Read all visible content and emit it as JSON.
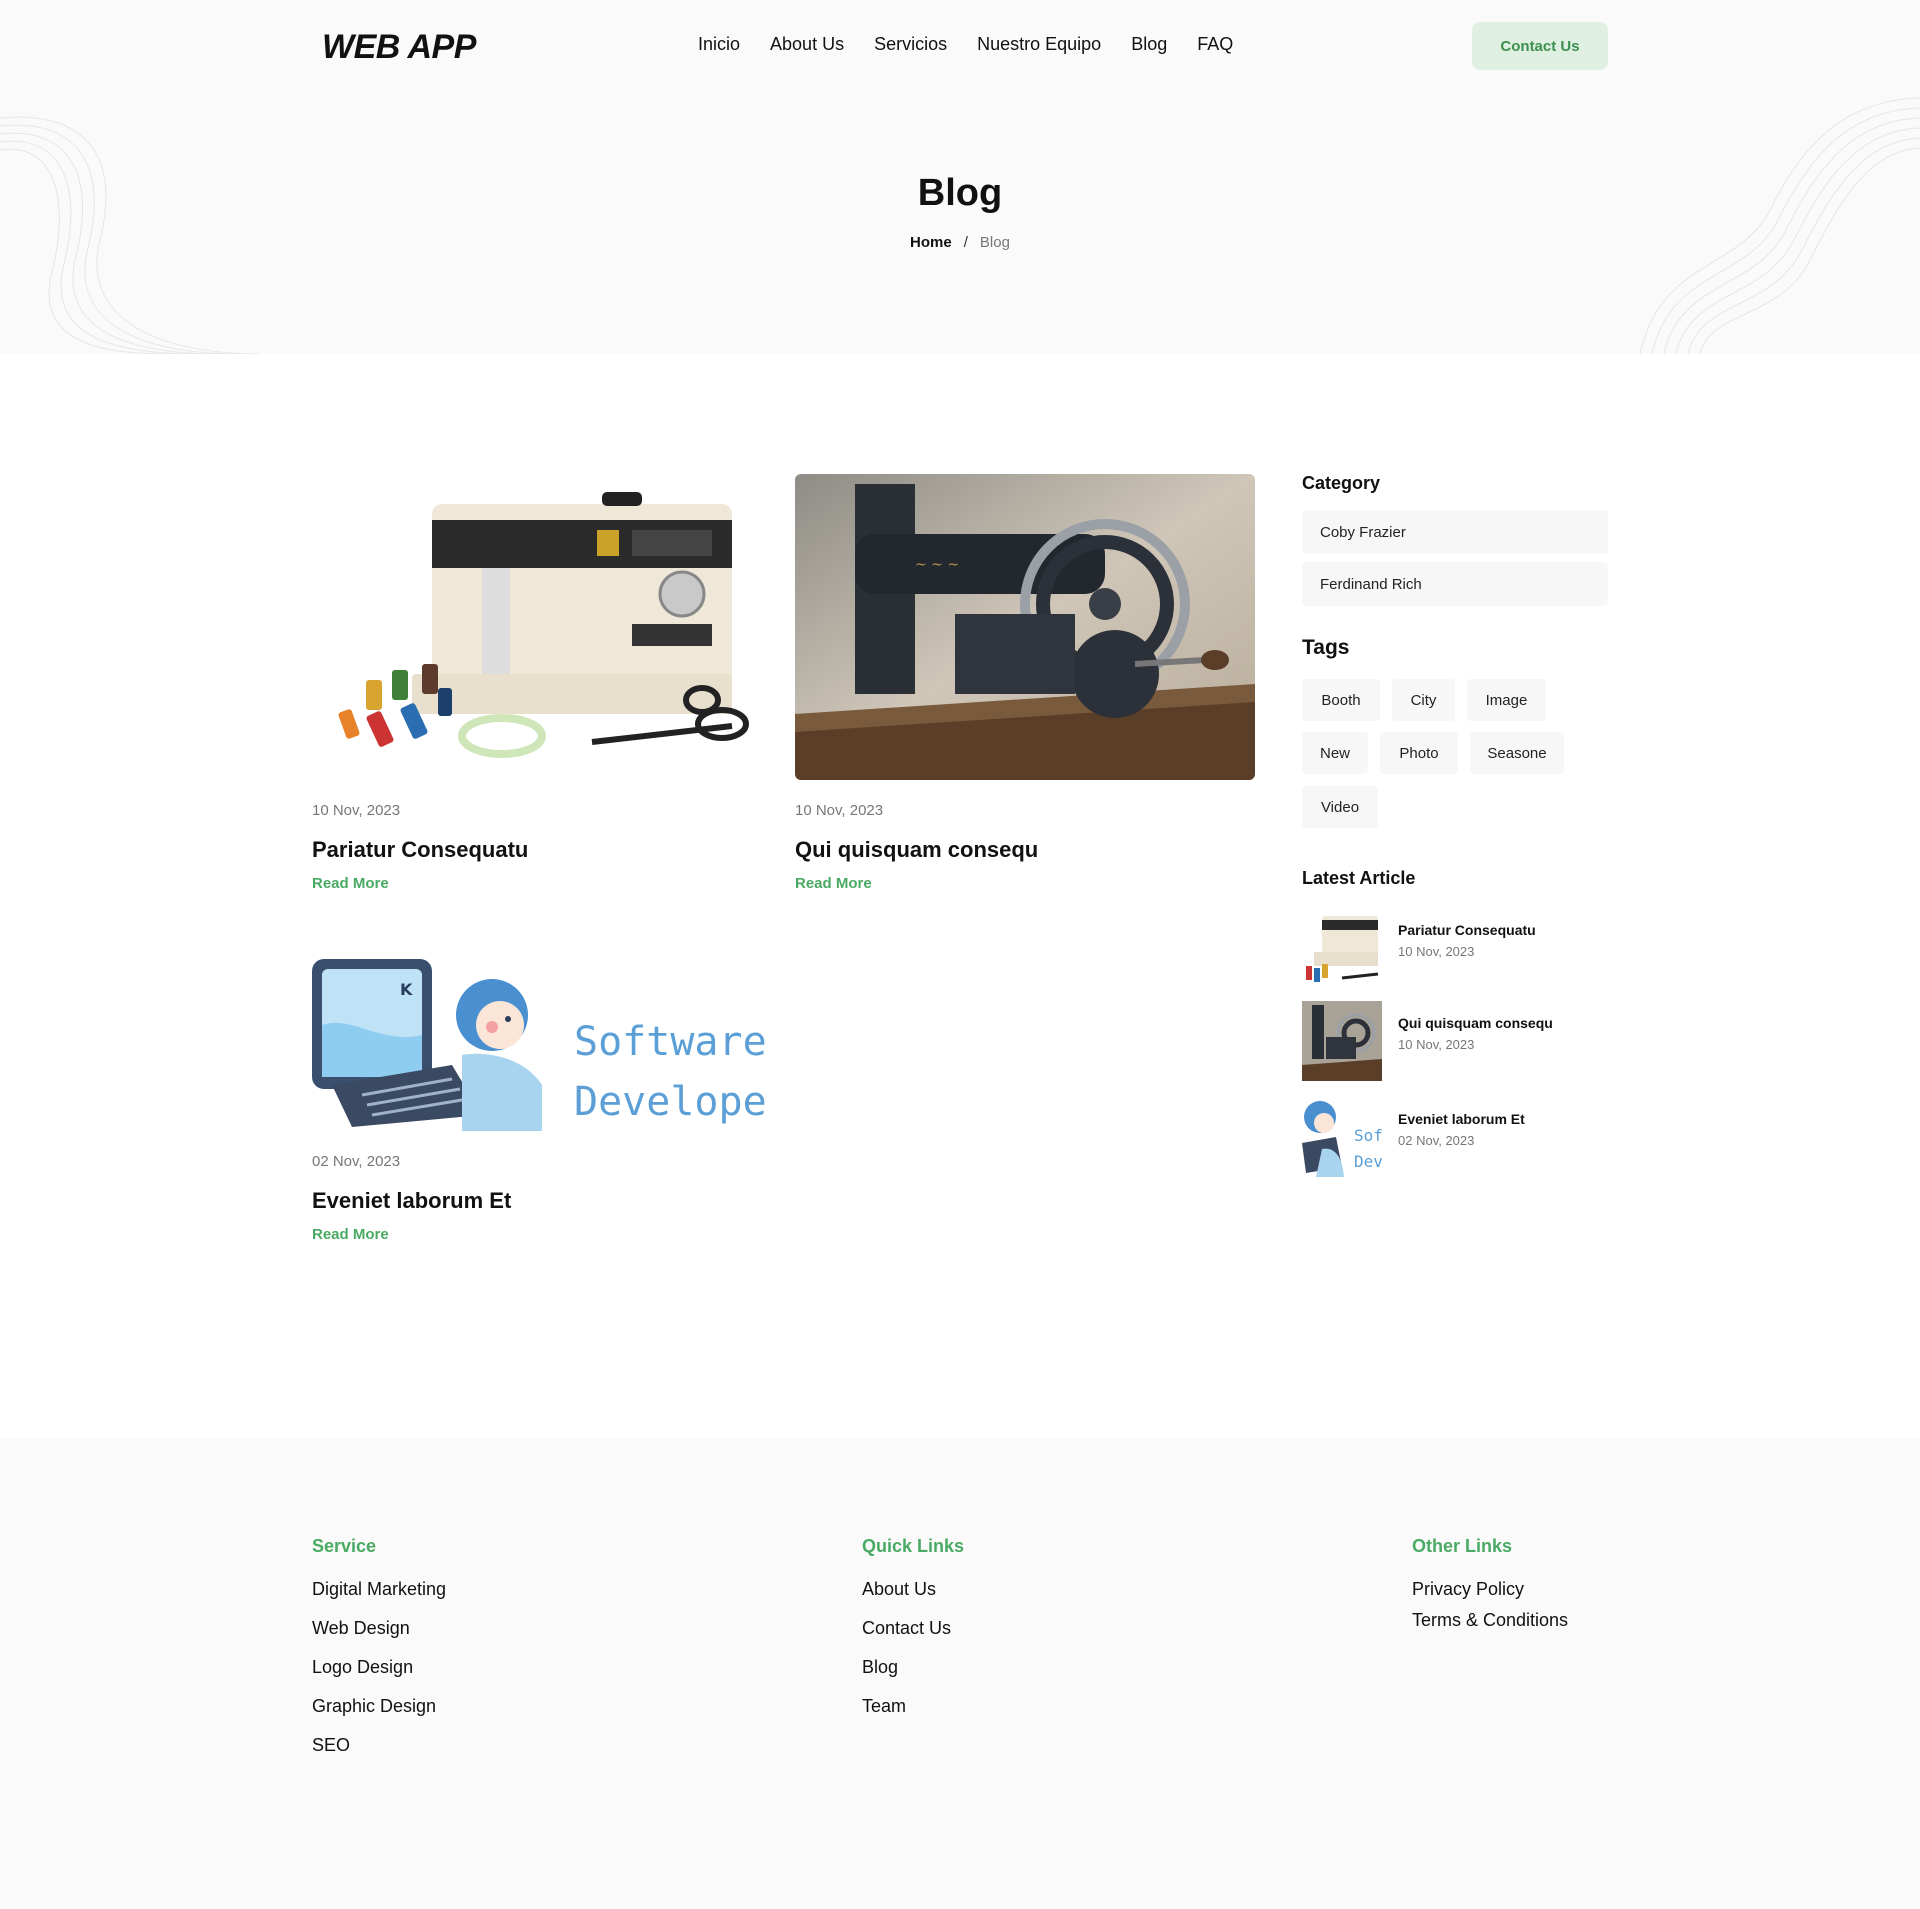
{
  "header": {
    "logo": "WEB APP",
    "nav": [
      "Inicio",
      "About Us",
      "Servicios",
      "Nuestro Equipo",
      "Blog",
      "FAQ"
    ],
    "contact_label": "Contact Us"
  },
  "hero": {
    "title": "Blog",
    "breadcrumb": {
      "home": "Home",
      "separator": "/",
      "current": "Blog"
    }
  },
  "posts": [
    {
      "date": "10 Nov, 2023",
      "title": "Pariatur Consequatu",
      "read_more": "Read More",
      "image": "sewing-machine-white"
    },
    {
      "date": "10 Nov, 2023",
      "title": "Qui quisquam consequ",
      "read_more": "Read More",
      "image": "sewing-machine-vintage"
    },
    {
      "date": "02 Nov, 2023",
      "title": "Eveniet laborum Et",
      "read_more": "Read More",
      "image": "software-developer-illustration",
      "image_text": [
        "Software",
        "Developer"
      ],
      "screen_letter": "K"
    }
  ],
  "sidebar": {
    "category_heading": "Category",
    "categories": [
      "Coby Frazier",
      "Ferdinand Rich"
    ],
    "tags_heading": "Tags",
    "tags": [
      "Booth",
      "City",
      "Image",
      "New",
      "Photo",
      "Seasone",
      "Video"
    ],
    "latest_heading": "Latest Article",
    "latest": [
      {
        "title": "Pariatur Consequatu",
        "date": "10 Nov, 2023"
      },
      {
        "title": "Qui quisquam consequ",
        "date": "10 Nov, 2023"
      },
      {
        "title": "Eveniet laborum Et",
        "date": "02 Nov, 2023",
        "thumb_text": [
          "Sof",
          "Dev"
        ]
      }
    ]
  },
  "footer": {
    "service": {
      "heading": "Service",
      "links": [
        "Digital Marketing",
        "Web Design",
        "Logo Design",
        "Graphic Design",
        "SEO"
      ]
    },
    "quick": {
      "heading": "Quick Links",
      "links": [
        "About Us",
        "Contact Us",
        "Blog",
        "Team"
      ]
    },
    "other": {
      "heading": "Other Links",
      "links": [
        "Privacy Policy",
        "Terms & Conditions"
      ]
    }
  },
  "colors": {
    "accent": "#4aaa63",
    "accent_bg": "#dff0e2",
    "hero_bg": "#fafafa"
  }
}
